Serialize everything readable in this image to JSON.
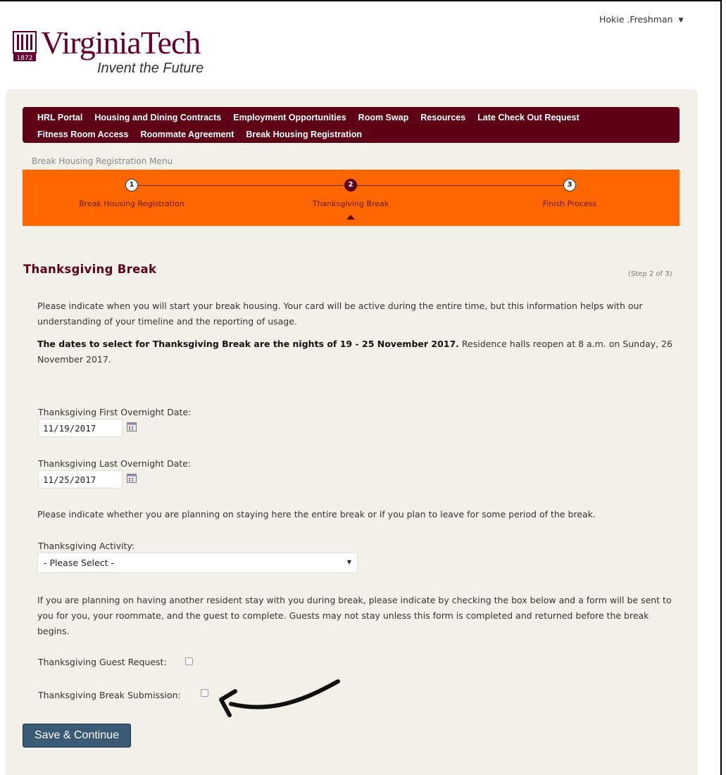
{
  "header": {
    "user_name": "Hokie .Freshman",
    "user_caret": "▼",
    "logo_wordmark": "VirginiaTech",
    "logo_tagline": "Invent the Future",
    "logo_seal_year": "1872"
  },
  "nav": {
    "row1": [
      "HRL Portal",
      "Housing and Dining Contracts",
      "Employment Opportunities",
      "Room Swap",
      "Resources",
      "Late Check Out Request"
    ],
    "row2": [
      "Fitness Room Access",
      "Roommate Agreement",
      "Break Housing Registration"
    ],
    "active": "Break Housing Registration"
  },
  "menu_title": "Break Housing Registration Menu",
  "stepper": {
    "steps": [
      {
        "num": "1",
        "label": "Break Housing Registration",
        "state": "done"
      },
      {
        "num": "2",
        "label": "Thanksgiving Break",
        "state": "current"
      },
      {
        "num": "3",
        "label": "Finish Process",
        "state": "upcoming"
      }
    ]
  },
  "page": {
    "title": "Thanksgiving Break",
    "step_of": "(Step 2 of 3)",
    "intro": "Please indicate when you will start your break housing.  Your card will be active during the entire time, but this information helps with our understanding of your timeline and the reporting of usage.",
    "dates_bold": "The dates to select for Thanksgiving Break are the nights of 19 - 25 November 2017.",
    "dates_rest": "  Residence halls reopen at  8 a.m. on Sunday, 26 November 2017.",
    "first_date_label": "Thanksgiving First Overnight Date:",
    "first_date_value": "11/19/2017",
    "last_date_label": "Thanksgiving Last Overnight Date:",
    "last_date_value": "11/25/2017",
    "stay_prompt": "Please indicate whether you are planning on staying here the entire break or if you plan to leave for some period of the break.",
    "activity_label": "Thanksgiving Activity:",
    "activity_selected": "- Please Select -",
    "guest_info": "If you are planning on having another resident stay with you during break, please indicate by checking the box below and a form will be sent to you for you, your roommate, and the guest to complete.  Guests may not stay unless this form is completed and returned before the break begins.",
    "guest_label": "Thanksgiving Guest Request:",
    "guest_checked": false,
    "submission_label": "Thanksgiving Break Submission:",
    "submission_checked": false,
    "save_label": "Save & Continue"
  },
  "colors": {
    "maroon": "#5e0016",
    "orange": "#ff6600",
    "panel_bg": "#f1f1ea",
    "button_bg": "#3a5a76"
  }
}
